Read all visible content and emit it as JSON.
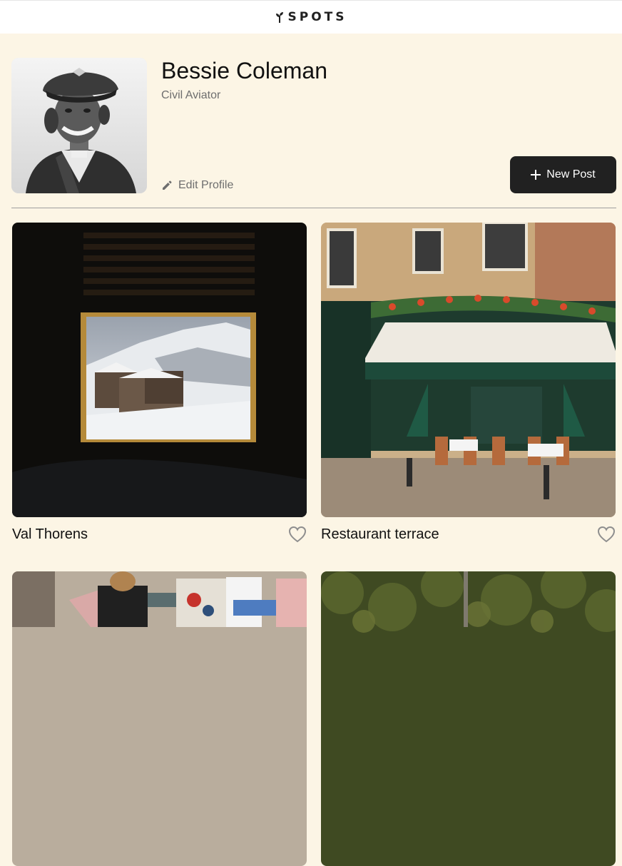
{
  "header": {
    "logo_text": "SPOTS",
    "logo_icon": "sprout-icon"
  },
  "profile": {
    "name": "Bessie Coleman",
    "description": "Civil Aviator",
    "edit_label": "Edit Profile",
    "new_post_label": "New Post"
  },
  "cards": [
    {
      "title": "Val Thorens",
      "image": "snowy-mountain-through-window"
    },
    {
      "title": "Restaurant terrace",
      "image": "paris-cafe-facade"
    },
    {
      "title": "",
      "image": "people-at-cafe-tables"
    },
    {
      "title": "",
      "image": "forest-treetops"
    }
  ],
  "colors": {
    "background": "#fcf5e5",
    "header_bg": "#ffffff",
    "button_bg": "#212121",
    "text": "#212121",
    "muted_text": "#6e6e6e"
  }
}
